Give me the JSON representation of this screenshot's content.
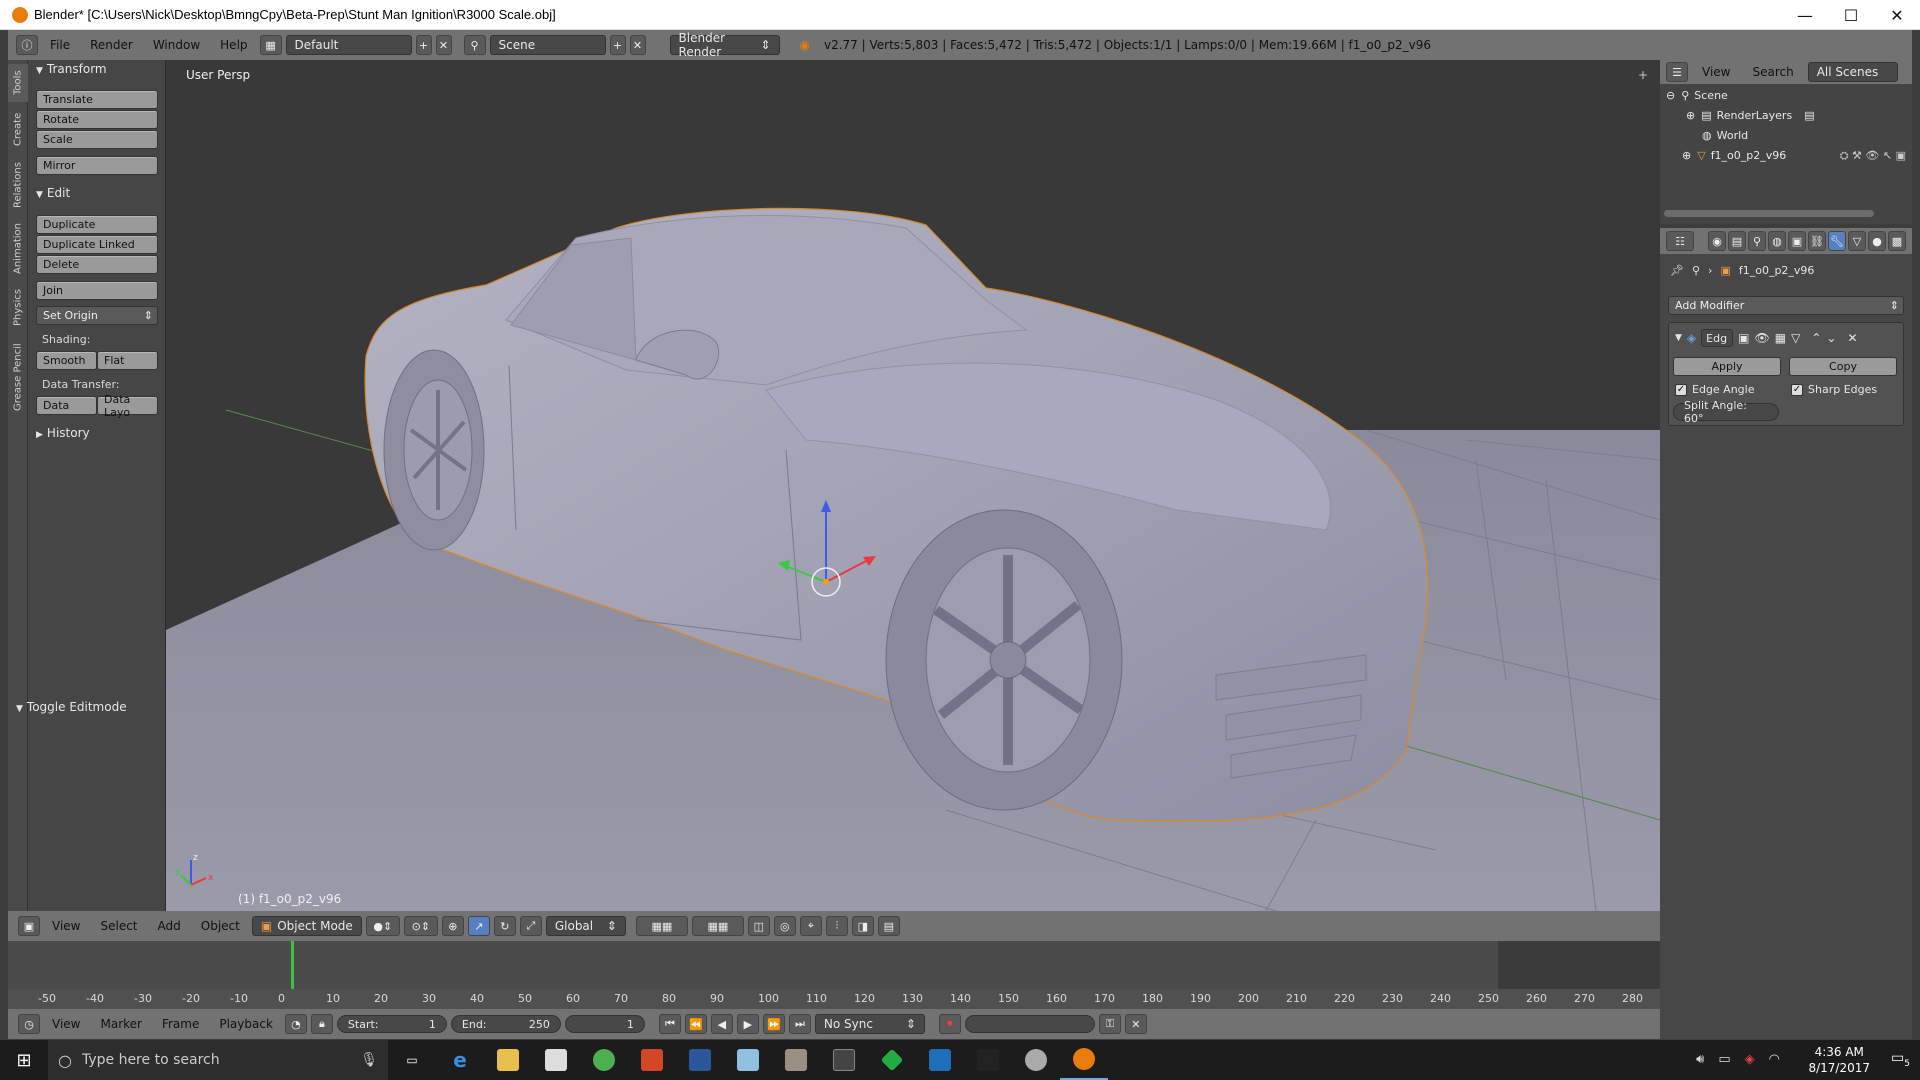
{
  "window": {
    "title": "Blender* [C:\\Users\\Nick\\Desktop\\BmngCpy\\Beta-Prep\\Stunt Man Ignition\\R3000 Scale.obj]",
    "controls": [
      "—",
      "☐",
      "✕"
    ]
  },
  "header": {
    "menus": [
      "File",
      "Render",
      "Window",
      "Help"
    ],
    "layout": "Default",
    "scene": "Scene",
    "engine": "Blender Render",
    "stats": "v2.77 | Verts:5,803 | Faces:5,472 | Tris:5,472 | Objects:1/1 | Lamps:0/0 | Mem:19.66M | f1_o0_p2_v96"
  },
  "tabs": [
    "Tools",
    "Create",
    "Relations",
    "Animation",
    "Physics",
    "Grease Pencil"
  ],
  "toolshelf": {
    "transform": {
      "title": "Transform",
      "buttons": [
        "Translate",
        "Rotate",
        "Scale",
        "Mirror"
      ]
    },
    "edit": {
      "title": "Edit",
      "buttons": [
        "Duplicate",
        "Duplicate Linked",
        "Delete",
        "Join"
      ],
      "set_origin": "Set Origin"
    },
    "shading": {
      "label": "Shading:",
      "smooth": "Smooth",
      "flat": "Flat"
    },
    "data_transfer": {
      "label": "Data Transfer:",
      "data": "Data",
      "data_layout": "Data Layo"
    },
    "history": "History",
    "toggle_editmode": "Toggle Editmode"
  },
  "viewport": {
    "view_label": "User Persp",
    "object_label": "(1) f1_o0_p2_v96",
    "axis_x": "x",
    "axis_y": "y",
    "axis_z": "z"
  },
  "viewport_header": {
    "menus": [
      "View",
      "Select",
      "Add",
      "Object"
    ],
    "mode": "Object Mode",
    "orientation": "Global"
  },
  "timeline": {
    "ticks": [
      "-50",
      "-40",
      "-30",
      "-20",
      "-10",
      "0",
      "10",
      "20",
      "30",
      "40",
      "50",
      "60",
      "70",
      "80",
      "90",
      "100",
      "110",
      "120",
      "130",
      "140",
      "150",
      "160",
      "170",
      "180",
      "190",
      "200",
      "210",
      "220",
      "230",
      "240",
      "250",
      "260",
      "270",
      "280"
    ],
    "menus": [
      "View",
      "Marker",
      "Frame",
      "Playback"
    ],
    "start_label": "Start:",
    "start_value": "1",
    "end_label": "End:",
    "end_value": "250",
    "current_frame": "1",
    "sync": "No Sync"
  },
  "outliner": {
    "menus": [
      "View",
      "Search"
    ],
    "filter": "All Scenes",
    "items": [
      "Scene",
      "RenderLayers",
      "World",
      "f1_o0_p2_v96"
    ]
  },
  "properties": {
    "object_name": "f1_o0_p2_v96",
    "add_modifier": "Add Modifier",
    "modifier_name": "Edg",
    "apply": "Apply",
    "copy": "Copy",
    "edge_angle": "Edge Angle",
    "sharp_edges": "Sharp Edges",
    "split_angle": "Split Angle: 60°"
  },
  "taskbar": {
    "search_placeholder": "Type here to search",
    "time": "4:36 AM",
    "date": "8/17/2017",
    "notifications": "5"
  }
}
